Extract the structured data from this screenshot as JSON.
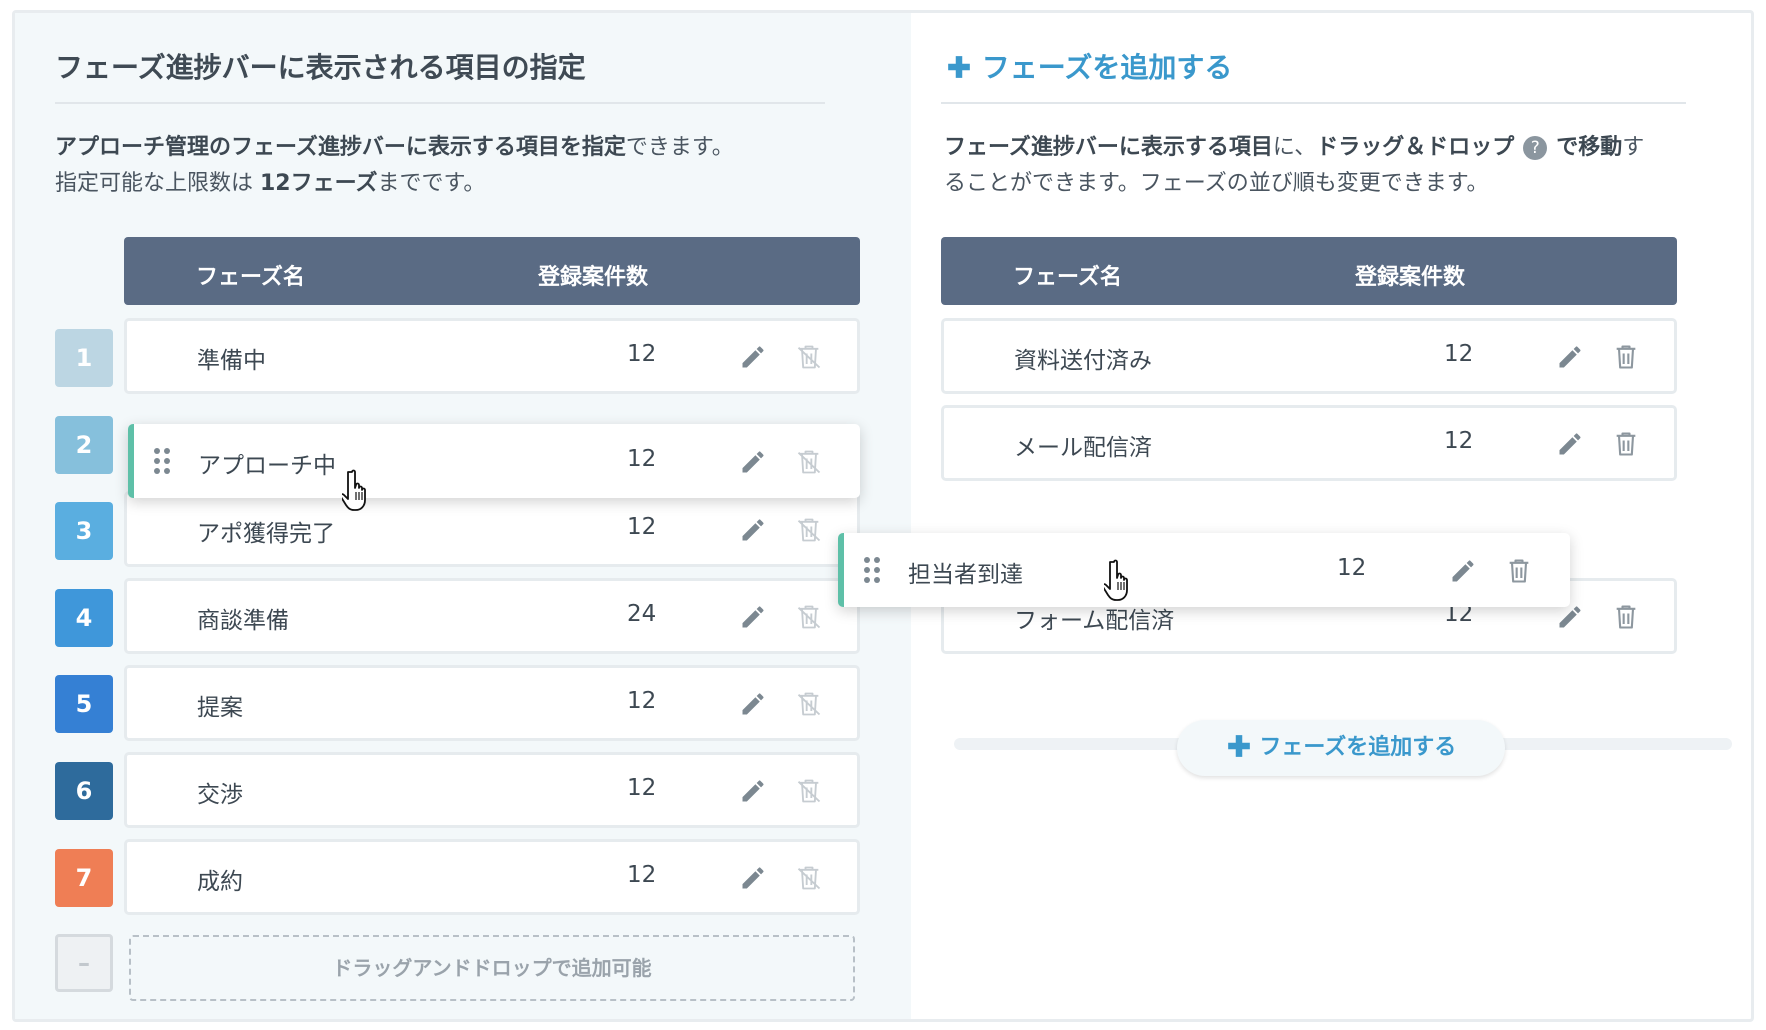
{
  "left": {
    "title": "フェーズ進捗バーに表示される項目の指定",
    "desc_line1_bold": "アプローチ管理のフェーズ進捗バーに表示する項目を指定",
    "desc_line1_rest": "できます。",
    "desc_line2_pre": "指定可能な上限数は ",
    "desc_line2_bold": "12フェーズ",
    "desc_line2_post": "までです。",
    "col_name": "フェーズ名",
    "col_count": "登録案件数",
    "numbers": [
      "1",
      "2",
      "3",
      "4",
      "5",
      "6",
      "7"
    ],
    "number_colors": [
      "#bcd6e3",
      "#86c0dc",
      "#5aaee0",
      "#3f97da",
      "#3580d4",
      "#2e6b9c",
      "#ef7e55"
    ],
    "placeholder_number": "–",
    "rows": [
      {
        "name": "準備中",
        "count": "12"
      },
      {
        "name": "アプローチ中",
        "count": "12"
      },
      {
        "name": "アポ獲得完了",
        "count": "12"
      },
      {
        "name": "商談準備",
        "count": "24"
      },
      {
        "name": "提案",
        "count": "12"
      },
      {
        "name": "交渉",
        "count": "12"
      },
      {
        "name": "成約",
        "count": "12"
      }
    ],
    "dropzone": "ドラッグアンドドロップで追加可能"
  },
  "right": {
    "title": "フェーズを追加する",
    "desc_a_bold": "フェーズ進捗バーに表示する項目",
    "desc_b": "に、",
    "desc_c_bold": "ドラッグ＆ドロップ",
    "desc_d_bold": "で移動",
    "desc_e": "す",
    "desc_line2": "ることができます。フェーズの並び順も変更できます。",
    "help": "?",
    "col_name": "フェーズ名",
    "col_count": "登録案件数",
    "rows": [
      {
        "name": "資料送付済み",
        "count": "12"
      },
      {
        "name": "メール配信済",
        "count": "12"
      },
      {
        "name": "担当者到達",
        "count": "12"
      },
      {
        "name": "フォーム配信済",
        "count": "12"
      }
    ],
    "add_button": "フェーズを追加する"
  },
  "colors": {
    "header_bg": "#5a6b84",
    "accent_blue": "#3a98cc",
    "drag_accent": "#5ec0a8",
    "left_bg": "#f3f8fa"
  },
  "icons": [
    "plus-icon",
    "pencil-icon",
    "trash-icon",
    "drag-handle-icon",
    "hand-cursor-icon",
    "help-icon"
  ]
}
